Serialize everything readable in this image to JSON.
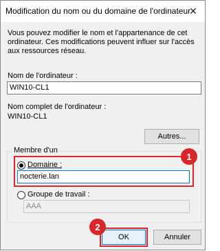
{
  "window": {
    "title": "Modification du nom ou du domaine de l'ordinateur",
    "close_glyph": "✕"
  },
  "description": "Vous pouvez modifier le nom et l'appartenance de cet ordinateur. Ces modifications peuvent influer sur l'accès aux ressources réseau.",
  "computer_name": {
    "label": "Nom de l'ordinateur :",
    "value": "WIN10-CL1"
  },
  "full_name": {
    "label": "Nom complet de l'ordinateur :",
    "value": "WIN10-CL1"
  },
  "more_button": "Autres...",
  "member_of": {
    "label": "Membre d'un",
    "domain": {
      "label": "Domaine :",
      "value": "nocterie.lan",
      "selected": true
    },
    "workgroup": {
      "label": "Groupe de travail :",
      "value": "AAA",
      "selected": false
    }
  },
  "buttons": {
    "ok": "OK",
    "cancel": "Annuler"
  },
  "markers": {
    "one": "1",
    "two": "2"
  },
  "colors": {
    "highlight": "#e0262a",
    "marker": "#d9262b"
  }
}
